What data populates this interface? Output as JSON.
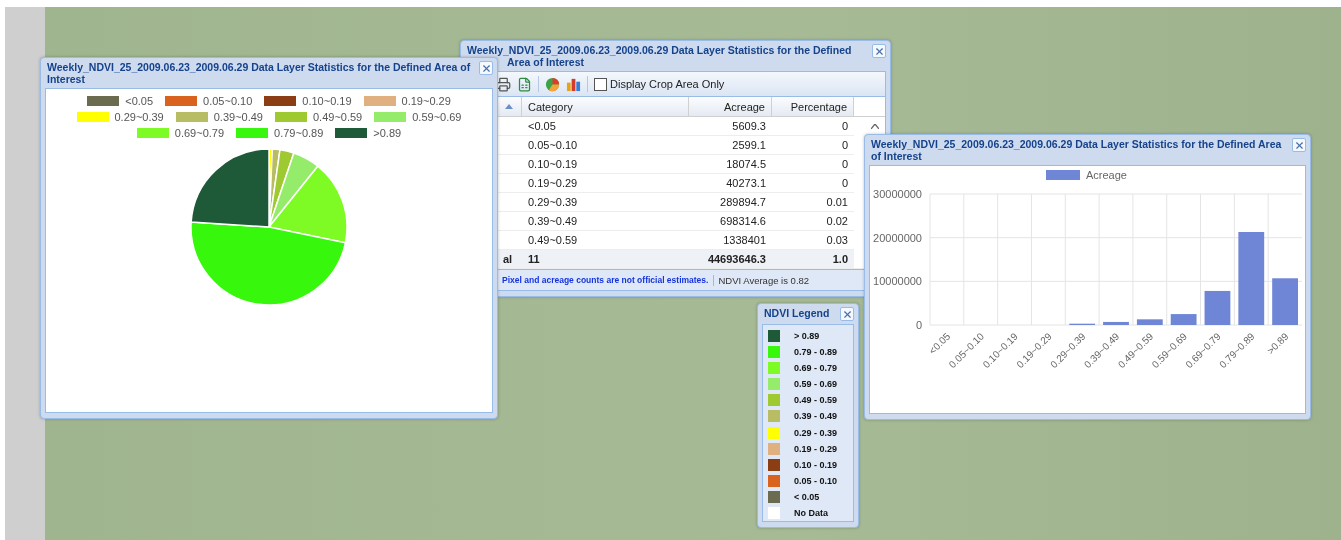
{
  "pie_window": {
    "title": "Weekly_NDVI_25_2009.06.23_2009.06.29 Data Layer Statistics for the Defined Area of Interest",
    "legend": [
      {
        "label": "<0.05",
        "color": "#6b6b4f"
      },
      {
        "label": "0.05~0.10",
        "color": "#d9621f"
      },
      {
        "label": "0.10~0.19",
        "color": "#8b3d14"
      },
      {
        "label": "0.19~0.29",
        "color": "#e0b080"
      },
      {
        "label": "0.29~0.39",
        "color": "#ffff00"
      },
      {
        "label": "0.39~0.49",
        "color": "#b8bd64"
      },
      {
        "label": "0.49~0.59",
        "color": "#9ec930"
      },
      {
        "label": "0.59~0.69",
        "color": "#95ec6b"
      },
      {
        "label": "0.69~0.79",
        "color": "#7efb25"
      },
      {
        "label": "0.79~0.89",
        "color": "#37f70d"
      },
      {
        "label": ">0.89",
        "color": "#1f5a38"
      }
    ]
  },
  "table_window": {
    "title": "Weekly_NDVI_25_2009.06.23_2009.06.29 Data Layer Statistics for the Defined Area of Interest",
    "checkbox": {
      "label": "Display Crop Area Only",
      "checked": false
    },
    "columns": [
      "Category",
      "Acreage",
      "Percentage"
    ],
    "rows": [
      {
        "category": "<0.05",
        "acreage": "5609.3",
        "percentage": "0"
      },
      {
        "category": "0.05~0.10",
        "acreage": "2599.1",
        "percentage": "0"
      },
      {
        "category": "0.10~0.19",
        "acreage": "18074.5",
        "percentage": "0"
      },
      {
        "category": "0.19~0.29",
        "acreage": "40273.1",
        "percentage": "0"
      },
      {
        "category": "0.29~0.39",
        "acreage": "289894.7",
        "percentage": "0.01"
      },
      {
        "category": "0.39~0.49",
        "acreage": "698314.6",
        "percentage": "0.02"
      },
      {
        "category": "0.49~0.59",
        "acreage": "1338401",
        "percentage": "0.03"
      }
    ],
    "total": {
      "label": "al",
      "count": "11",
      "acreage": "44693646.3",
      "percentage": "1.0"
    },
    "notice": "Pixel and acreage counts are not official estimates.",
    "average": "NDVI Average is 0.82"
  },
  "bar_window": {
    "title": "Weekly_NDVI_25_2009.06.23_2009.06.29 Data Layer Statistics for the Defined Area of Interest",
    "chart_data": {
      "type": "bar",
      "categories": [
        "<0.05",
        "0.05~0.10",
        "0.10~0.19",
        "0.19~0.29",
        "0.29~0.39",
        "0.39~0.49",
        "0.49~0.59",
        "0.59~0.69",
        "0.69~0.79",
        "0.79~0.89",
        ">0.89"
      ],
      "series": [
        {
          "name": "Acreage",
          "color": "#6f86d6",
          "values": [
            0,
            0,
            0,
            0,
            300000,
            700000,
            1300000,
            2500000,
            7800000,
            21300000,
            10700000
          ]
        }
      ],
      "ylim": [
        0,
        30000000
      ],
      "yticks": [
        0,
        10000000,
        20000000,
        30000000
      ]
    }
  },
  "ndvi_legend": {
    "title": "NDVI Legend",
    "items": [
      {
        "label": "> 0.89",
        "color": "#1f5a38"
      },
      {
        "label": "0.79 - 0.89",
        "color": "#37f70d"
      },
      {
        "label": "0.69 - 0.79",
        "color": "#7efb25"
      },
      {
        "label": "0.59 - 0.69",
        "color": "#95ec6b"
      },
      {
        "label": "0.49 - 0.59",
        "color": "#9ec930"
      },
      {
        "label": "0.39 - 0.49",
        "color": "#b8bd64"
      },
      {
        "label": "0.29 - 0.39",
        "color": "#ffff00"
      },
      {
        "label": "0.19 - 0.29",
        "color": "#e0b080"
      },
      {
        "label": "0.10 - 0.19",
        "color": "#8b3d14"
      },
      {
        "label": "0.05 - 0.10",
        "color": "#d9621f"
      },
      {
        "label": "< 0.05",
        "color": "#6b6b4f"
      },
      {
        "label": "No Data",
        "color": "#ffffff"
      }
    ]
  }
}
